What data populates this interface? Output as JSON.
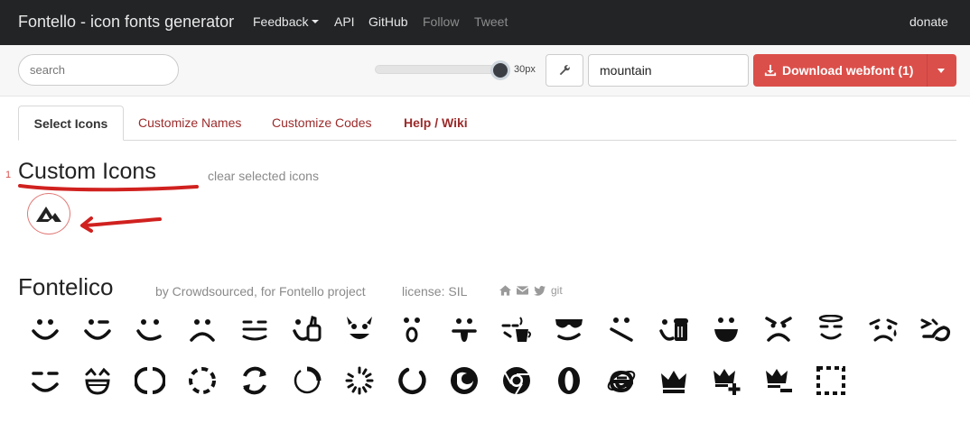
{
  "navbar": {
    "brand": "Fontello - icon fonts generator",
    "feedback": "Feedback",
    "api": "API",
    "github": "GitHub",
    "follow": "Follow",
    "tweet": "Tweet",
    "donate": "donate"
  },
  "toolbar": {
    "search_placeholder": "search",
    "size_label": "30px",
    "font_name_value": "mountain",
    "download_label": "Download webfont (1)"
  },
  "tabs": {
    "select_icons": "Select Icons",
    "customize_names": "Customize Names",
    "customize_codes": "Customize Codes",
    "help_wiki": "Help / Wiki"
  },
  "custom_section": {
    "count": "1",
    "title": "Custom Icons",
    "clear_link": "clear selected icons",
    "icon": "mountain-icon"
  },
  "fontelico": {
    "title": "Fontelico",
    "author": "by Crowdsourced, for Fontello project",
    "license": "license: SIL",
    "git": "git",
    "row1_icons": [
      "emo-happy",
      "emo-wink",
      "emo-wink2",
      "emo-unhappy",
      "emo-sleep",
      "emo-thumbsup",
      "emo-devil",
      "emo-surprised",
      "emo-tongue",
      "emo-coffee",
      "emo-sunglasses",
      "emo-displeased",
      "emo-beer",
      "emo-grin",
      "emo-angry",
      "emo-saint",
      "emo-cry",
      "emo-squint"
    ],
    "row2_icons": [
      "emo-laugh",
      "emo-laugh-open",
      "spin1",
      "spin2",
      "spin3",
      "spin4",
      "spin5",
      "spin6",
      "firefox",
      "chrome",
      "opera",
      "ie",
      "crown",
      "crown-plus",
      "crown-minus",
      "marquee"
    ]
  },
  "colors": {
    "navbar_bg": "#222426",
    "accent_red": "#db4f4a",
    "tab_link": "#9c2b2b"
  }
}
